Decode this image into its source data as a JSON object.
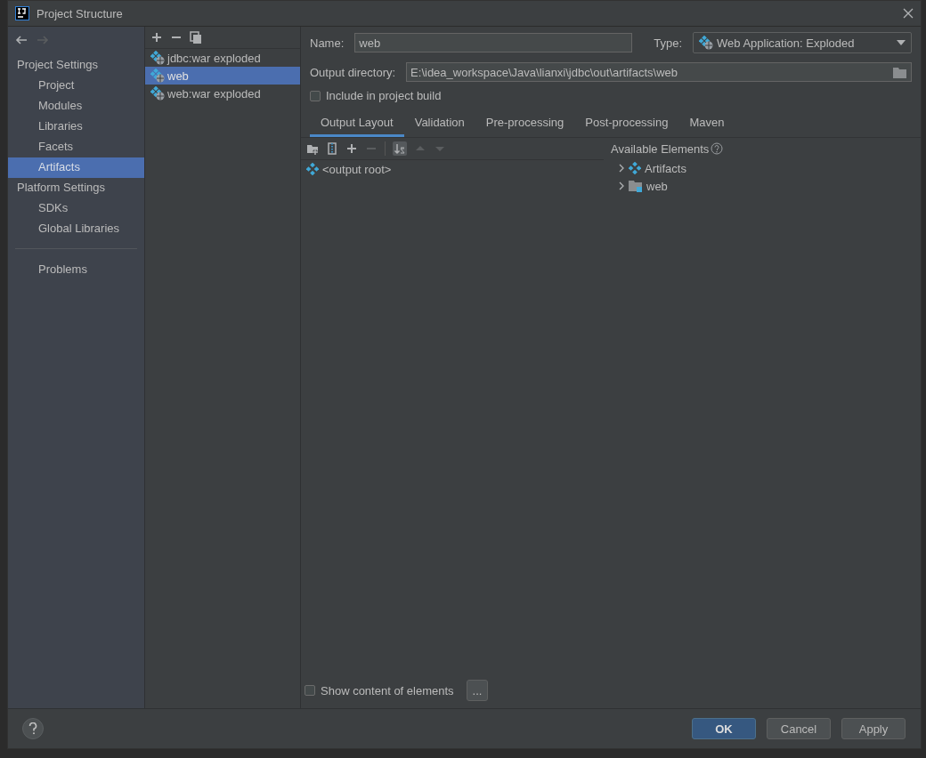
{
  "window": {
    "title": "Project Structure"
  },
  "nav": [
    {
      "kind": "back",
      "disabled": false
    },
    {
      "kind": "forward",
      "disabled": true
    }
  ],
  "sidebar": {
    "sections": [
      {
        "heading": "Project Settings",
        "items": [
          {
            "label": "Project",
            "selected": false
          },
          {
            "label": "Modules",
            "selected": false
          },
          {
            "label": "Libraries",
            "selected": false
          },
          {
            "label": "Facets",
            "selected": false
          },
          {
            "label": "Artifacts",
            "selected": true
          }
        ]
      },
      {
        "heading": "Platform Settings",
        "items": [
          {
            "label": "SDKs",
            "selected": false
          },
          {
            "label": "Global Libraries",
            "selected": false
          }
        ]
      }
    ],
    "extra_items": [
      {
        "label": "Problems",
        "selected": false
      }
    ]
  },
  "list_toolbar": [
    {
      "kind": "add",
      "disabled": false
    },
    {
      "kind": "remove",
      "disabled": false
    },
    {
      "kind": "copy",
      "disabled": false
    }
  ],
  "artifacts": [
    {
      "label": "jdbc:war exploded",
      "selected": false
    },
    {
      "label": "web",
      "selected": true
    },
    {
      "label": "web:war exploded",
      "selected": false
    }
  ],
  "form": {
    "name_label": "Name:",
    "name_value": "web",
    "type_label": "Type:",
    "type_value": "Web Application: Exploded",
    "output_label": "Output directory:",
    "output_value": "E:\\idea_workspace\\Java\\lianxi\\jdbc\\out\\artifacts\\web",
    "include": {
      "label": "Include in project build",
      "checked": false
    }
  },
  "tabs": [
    {
      "label": "Output Layout",
      "selected": true
    },
    {
      "label": "Validation",
      "selected": false
    },
    {
      "label": "Pre-processing",
      "selected": false
    },
    {
      "label": "Post-processing",
      "selected": false
    },
    {
      "label": "Maven",
      "selected": false
    }
  ],
  "layout_toolbar": [
    {
      "kind": "new-folder",
      "disabled": false
    },
    {
      "kind": "archive",
      "disabled": false
    },
    {
      "kind": "add",
      "disabled": false
    },
    {
      "kind": "remove",
      "disabled": true
    },
    {
      "kind": "sort",
      "disabled": false
    },
    {
      "kind": "up",
      "disabled": true
    },
    {
      "kind": "down",
      "disabled": true
    }
  ],
  "layout_tree": [
    {
      "label": "<output root>"
    }
  ],
  "available": {
    "title": "Available Elements",
    "items": [
      {
        "label": "Artifacts",
        "kind": "artifacts",
        "expanded": false
      },
      {
        "label": "web",
        "kind": "module",
        "expanded": false
      }
    ]
  },
  "show_content": {
    "label": "Show content of elements",
    "checked": false
  },
  "more_button": "...",
  "buttons": [
    {
      "label": "OK",
      "kind": "primary"
    },
    {
      "label": "Cancel",
      "kind": "normal"
    },
    {
      "label": "Apply",
      "kind": "normal"
    }
  ]
}
